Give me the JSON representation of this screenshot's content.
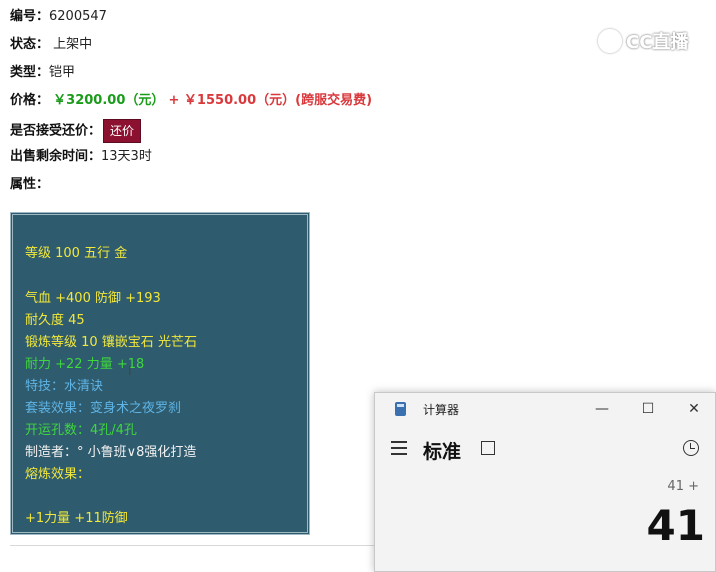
{
  "item": {
    "id_label": "编号：",
    "id_value": "6200547",
    "status_label": "状态：",
    "status_value": "上架中",
    "type_label": "类型：",
    "type_value": "铠甲",
    "price_label": "价格：",
    "price_main": "￥3200.00（元）",
    "price_extra": "+ ￥1550.00（元）(跨服交易费)",
    "bargain_label": "是否接受还价：",
    "bargain_button": "还价",
    "time_label": "出售剩余时间：",
    "time_value": "13天3时",
    "attr_label": "属性："
  },
  "watermark": "CC直播",
  "attributes": {
    "level": "等级 100 五行 金",
    "hp_def": "气血 +400 防御 +193",
    "durability": "耐久度 45",
    "forge": "锻炼等级 10 镶嵌宝石 光芒石",
    "stamina_str": "耐力 +22 力量 +18",
    "skill": "特技：水清诀",
    "set_effect": "套装效果：变身术之夜罗刹",
    "holes": "开运孔数：4孔/4孔",
    "maker": "制造者：° 小鲁班∨8强化打造",
    "smelt_label": "熔炼效果：",
    "smelt_value": "+1力量 +11防御"
  },
  "colors": {
    "panel_bg": "#2e5b6d",
    "yellow": "#f2e83c",
    "green": "#3fd63f",
    "blue": "#5fb4e6",
    "price_green": "#1a9b1a",
    "price_red": "#d9393c",
    "bargain_bg": "#8c1030"
  },
  "calculator": {
    "title": "计算器",
    "mode": "标准",
    "expression": "41 +",
    "display": "41",
    "icons": {
      "app": "calculator-icon",
      "menu": "hamburger-icon",
      "keep_on_top": "keep-on-top-icon",
      "history": "history-icon"
    },
    "window_buttons": {
      "minimize": "—",
      "maximize": "☐",
      "close": "✕"
    }
  }
}
